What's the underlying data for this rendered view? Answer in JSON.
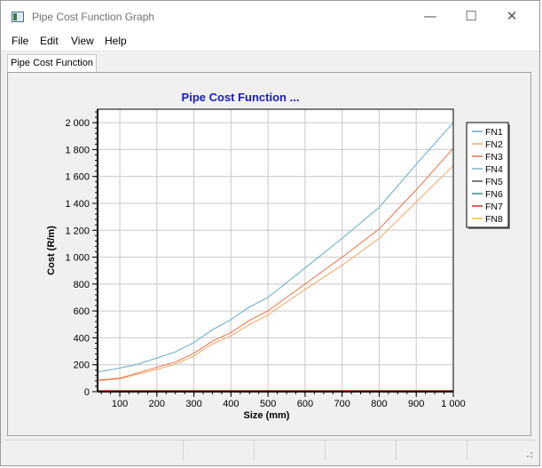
{
  "window": {
    "title": "Pipe Cost Function Graph",
    "controls": {
      "minimize": "—",
      "maximize": "☐",
      "close": "✕"
    }
  },
  "menu": [
    "File",
    "Edit",
    "View",
    "Help"
  ],
  "tabs": [
    {
      "label": "Pipe Cost Function"
    }
  ],
  "chart_data": {
    "type": "line",
    "title": "Pipe Cost Function ...",
    "xlabel": "Size (mm)",
    "ylabel": "Cost (R/m)",
    "xlim": [
      40,
      1000
    ],
    "ylim": [
      0,
      2100
    ],
    "x_ticks": [
      100,
      200,
      300,
      400,
      500,
      600,
      700,
      800,
      900,
      1000
    ],
    "x_tick_labels": [
      "100",
      "200",
      "300",
      "400",
      "500",
      "600",
      "700",
      "800",
      "900",
      "1 000"
    ],
    "y_ticks": [
      0,
      200,
      400,
      600,
      800,
      1000,
      1200,
      1400,
      1600,
      1800,
      2000
    ],
    "y_tick_labels": [
      "0",
      "200",
      "400",
      "600",
      "800",
      "1 000",
      "1 200",
      "1 400",
      "1 600",
      "1 800",
      "2 000"
    ],
    "grid": true,
    "legend_position": "right",
    "x": [
      40,
      100,
      150,
      200,
      250,
      300,
      350,
      400,
      450,
      500,
      600,
      700,
      800,
      900,
      1000
    ],
    "series": [
      {
        "name": "FN1",
        "color": "#6fa3c8",
        "values": [
          145,
          175,
          205,
          250,
          295,
          365,
          460,
          535,
          630,
          700,
          920,
          1140,
          1370,
          1690,
          2000
        ]
      },
      {
        "name": "FN2",
        "color": "#f0a860",
        "values": [
          80,
          95,
          130,
          165,
          205,
          265,
          355,
          415,
          500,
          570,
          760,
          940,
          1140,
          1410,
          1680
        ]
      },
      {
        "name": "FN3",
        "color": "#e87048",
        "values": [
          85,
          100,
          140,
          180,
          220,
          285,
          375,
          440,
          530,
          600,
          800,
          1000,
          1210,
          1500,
          1810
        ]
      },
      {
        "name": "FN4",
        "color": "#7ab8d0",
        "values": [
          145,
          175,
          205,
          250,
          295,
          365,
          460,
          535,
          630,
          700,
          920,
          1140,
          1370,
          1690,
          2000
        ]
      },
      {
        "name": "FN5",
        "color": "#505050",
        "values": [
          2,
          2,
          2,
          2,
          2,
          2,
          2,
          2,
          2,
          2,
          2,
          2,
          2,
          2,
          2
        ]
      },
      {
        "name": "FN6",
        "color": "#3a8a8a",
        "values": [
          3,
          3,
          3,
          3,
          3,
          3,
          3,
          3,
          3,
          3,
          3,
          3,
          3,
          3,
          3
        ]
      },
      {
        "name": "FN7",
        "color": "#d03020",
        "values": [
          5,
          5,
          5,
          5,
          5,
          5,
          5,
          5,
          5,
          5,
          5,
          5,
          5,
          5,
          5
        ]
      },
      {
        "name": "FN8",
        "color": "#f0c030",
        "values": [
          1,
          1,
          1,
          1,
          1,
          1,
          1,
          1,
          1,
          1,
          1,
          1,
          1,
          1,
          1
        ]
      }
    ]
  }
}
